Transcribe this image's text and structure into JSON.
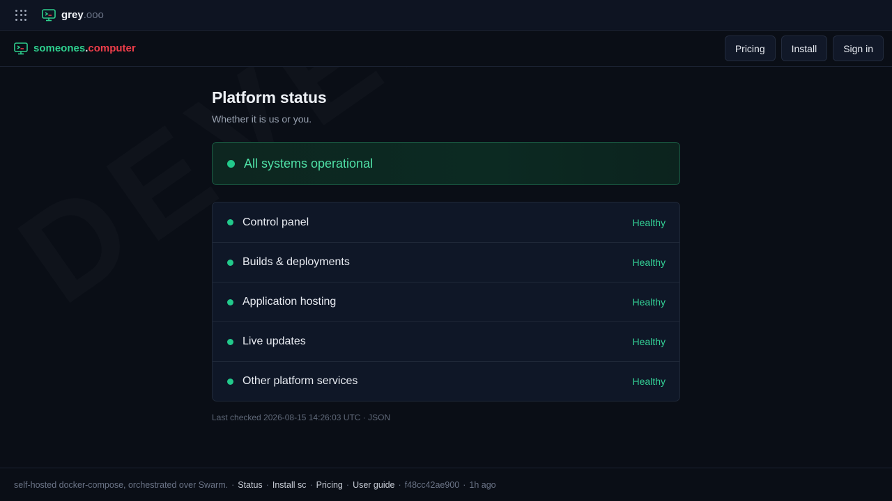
{
  "watermark": "DEVELOPER",
  "topbar": {
    "brand_name": "grey",
    "brand_tld": ".ooo",
    "apps_icon": "grid-icon",
    "brand_icon": "terminal-monitor-icon"
  },
  "navbar": {
    "site_part1": "someones",
    "site_dot": ".",
    "site_part2": "computer",
    "site_icon": "terminal-monitor-icon",
    "buttons": {
      "pricing": "Pricing",
      "install": "Install",
      "signin": "Sign in"
    }
  },
  "main": {
    "title": "Platform status",
    "subtitle": "Whether it is us or you.",
    "banner": "All systems operational",
    "services": [
      {
        "label": "Control panel",
        "state": "Healthy"
      },
      {
        "label": "Builds & deployments",
        "state": "Healthy"
      },
      {
        "label": "Application hosting",
        "state": "Healthy"
      },
      {
        "label": "Live updates",
        "state": "Healthy"
      },
      {
        "label": "Other platform services",
        "state": "Healthy"
      }
    ],
    "last_checked": "Last checked 2026-08-15 14:26:03 UTC",
    "json_link": "JSON"
  },
  "footer": {
    "lead": "self-hosted docker-compose, orchestrated over Swarm.",
    "links": {
      "status": "Status",
      "install": "Install sc",
      "pricing": "Pricing",
      "guide": "User guide"
    },
    "commit": "f48cc42ae900",
    "age": "1h ago"
  },
  "colors": {
    "accent_green": "#22c98b",
    "brand_red": "#ef3e4a",
    "background": "#0a0e16"
  }
}
